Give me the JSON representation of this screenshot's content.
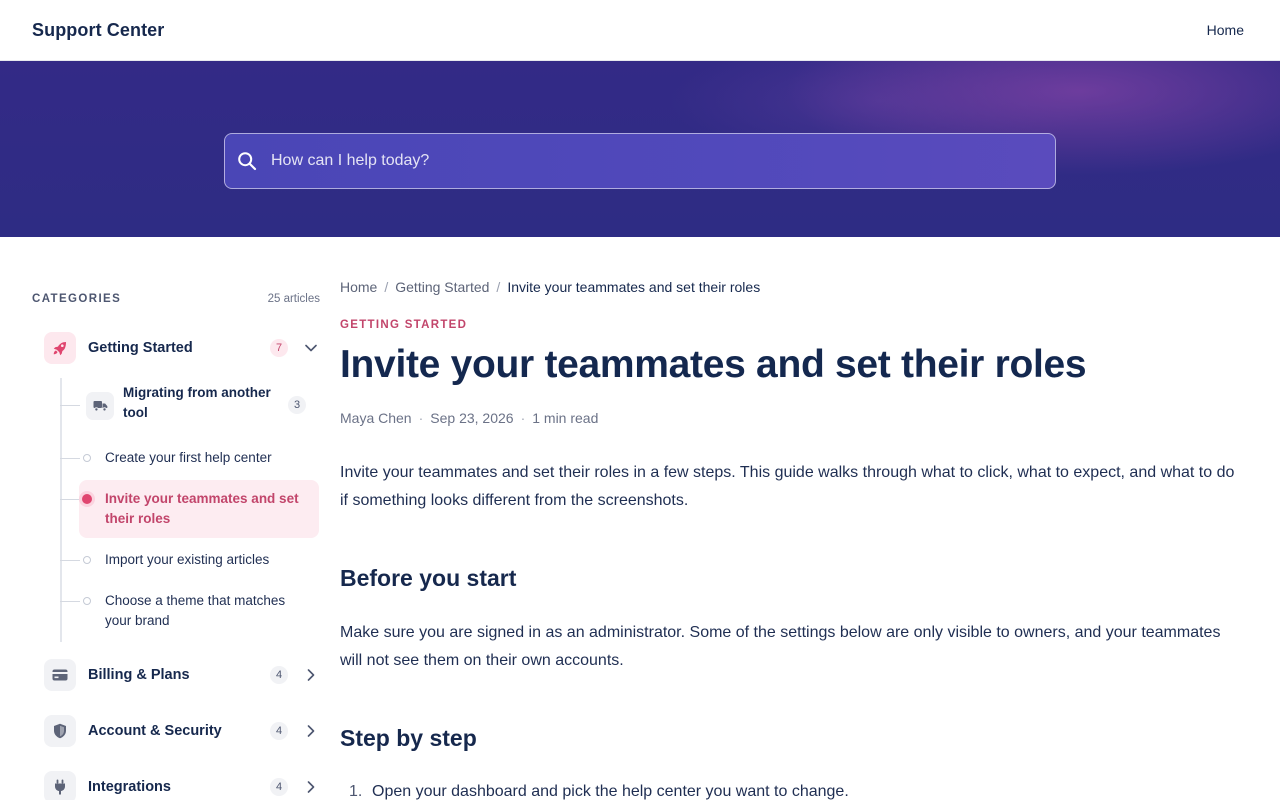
{
  "app": {
    "brand": "Support Center",
    "nav_home": "Home"
  },
  "search": {
    "placeholder": "How can I help today?"
  },
  "sidebar": {
    "heading": "CATEGORIES",
    "total": "25 articles",
    "categories": [
      {
        "label": "Getting Started",
        "count": "7",
        "icon": "rocket-icon",
        "expanded": true
      },
      {
        "label": "Billing & Plans",
        "count": "4",
        "icon": "credit-card-icon"
      },
      {
        "label": "Account & Security",
        "count": "4",
        "icon": "shield-icon"
      },
      {
        "label": "Integrations",
        "count": "4",
        "icon": "plug-icon"
      }
    ],
    "subcategory": {
      "label": "Migrating from another tool",
      "count": "3",
      "icon": "truck-icon"
    },
    "articles": [
      {
        "label": "Create your first help center"
      },
      {
        "label": "Invite your teammates and set their roles",
        "active": true
      },
      {
        "label": "Import your existing articles"
      },
      {
        "label": "Choose a theme that matches your brand"
      }
    ]
  },
  "breadcrumb": [
    "Home",
    "Getting Started",
    "Invite your teammates and set their roles"
  ],
  "article": {
    "category": "GETTING STARTED",
    "title": "Invite your teammates and set their roles",
    "author": "Maya Chen",
    "date": "Sep 23, 2026",
    "read_time": "1 min read",
    "intro": "Invite your teammates and set their roles in a few steps. This guide walks through what to click, what to expect, and what to do if something looks different from the screenshots.",
    "section1_heading": "Before you start",
    "section1_body": "Make sure you are signed in as an administrator. Some of the settings below are only visible to owners, and your teammates will not see them on their own accounts.",
    "section2_heading": "Step by step",
    "steps": [
      {
        "num": "1.",
        "text": "Open your dashboard and pick the help center you want to change."
      }
    ]
  },
  "colors": {
    "accent": "#c2456b",
    "hero": "#2e2c84",
    "text": "#16284d"
  }
}
